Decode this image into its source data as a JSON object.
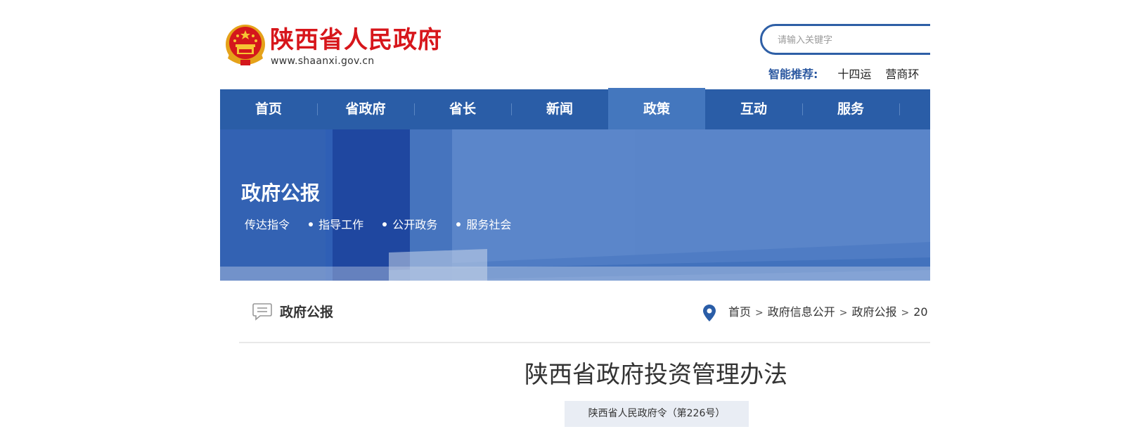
{
  "header": {
    "site_name": "陕西省人民政府",
    "site_url": "www.shaanxi.gov.cn"
  },
  "search": {
    "placeholder": "请输入关键字"
  },
  "hot": {
    "label": "智能推荐:",
    "items": [
      "十四运",
      "营商环"
    ]
  },
  "nav": {
    "items": [
      {
        "label": "首页"
      },
      {
        "label": "省政府"
      },
      {
        "label": "省长"
      },
      {
        "label": "新闻"
      },
      {
        "label": "政策"
      },
      {
        "label": "互动"
      },
      {
        "label": "服务"
      }
    ],
    "active_index": 4
  },
  "banner": {
    "title": "政府公报",
    "tags": [
      "传达指令",
      "指导工作",
      "公开政务",
      "服务社会"
    ]
  },
  "section": {
    "title": "政府公报"
  },
  "breadcrumb": {
    "items": [
      "首页",
      "政府信息公开",
      "政府公报",
      "20"
    ],
    "separator": ">"
  },
  "article": {
    "title": "陕西省政府投资管理办法",
    "decree": "陕西省人民政府令（第226号）"
  },
  "colors": {
    "brand_red": "#d7161b",
    "nav_blue": "#2a5da7",
    "nav_active": "#4477be",
    "accent_blue": "#2e5fa6"
  },
  "icons": [
    "national-emblem-icon",
    "comment-icon",
    "location-pin-icon"
  ]
}
